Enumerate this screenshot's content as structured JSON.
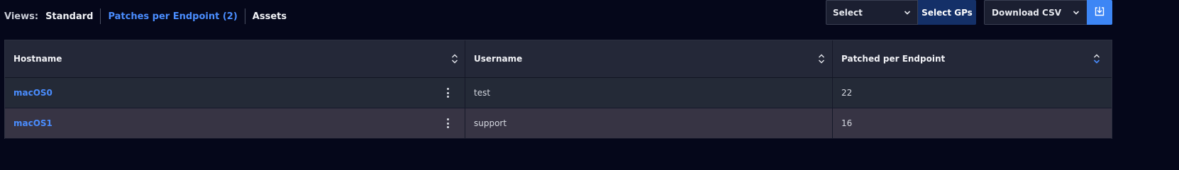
{
  "views": {
    "label": "Views:",
    "tabs": [
      {
        "label": "Standard",
        "active": false
      },
      {
        "label": "Patches per Endpoint (2)",
        "active": true
      },
      {
        "label": "Assets",
        "active": false
      }
    ]
  },
  "toolbar": {
    "select_value": "Select",
    "select_gps_label": "Select GPs",
    "download_value": "Download CSV"
  },
  "table": {
    "columns": [
      "Hostname",
      "Username",
      "Patched per Endpoint"
    ],
    "rows": [
      {
        "hostname": "macOS0",
        "username": "test",
        "patched": "22"
      },
      {
        "hostname": "macOS1",
        "username": "support",
        "patched": "16"
      }
    ]
  },
  "colors": {
    "accent": "#4a8dff",
    "primary_button": "#143068",
    "download_button": "#3d86f5",
    "background": "#05071a"
  },
  "icons": {
    "select_chevron": "chevron-down-icon",
    "download": "download-icon",
    "sort": "sort-icon",
    "row_menu": "kebab-menu-icon"
  }
}
